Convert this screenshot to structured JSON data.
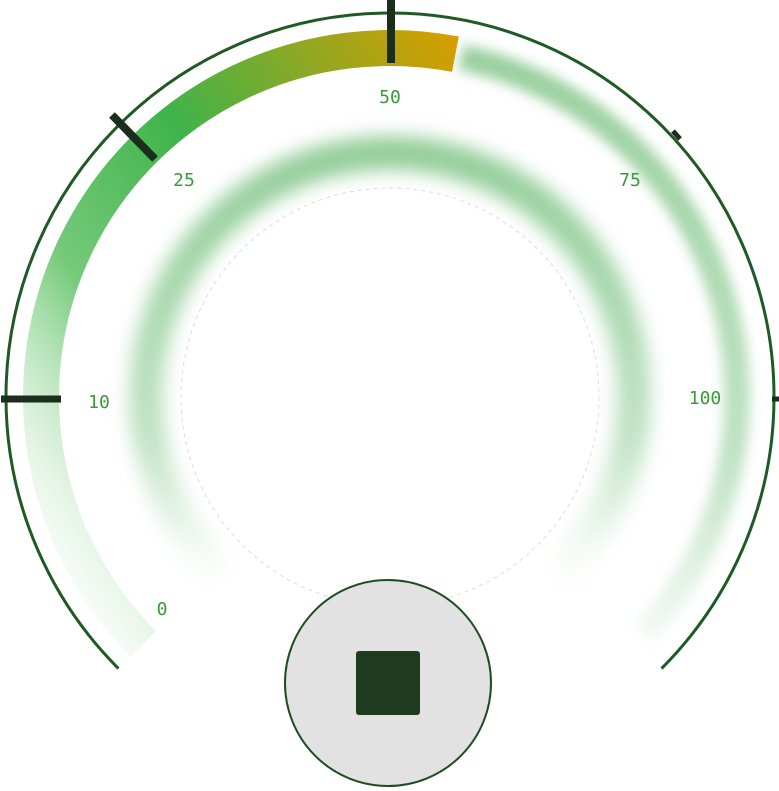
{
  "gauge": {
    "scale_labels": [
      "0",
      "10",
      "25",
      "50",
      "75",
      "100"
    ],
    "current_value_fraction": 0.54,
    "colors": {
      "outer_ring": "#1f5a26",
      "fill_start": "#47b84d",
      "fill_mid": "#3fb34b",
      "fill_end": "#d59e00",
      "track_glow": "#8fcb95",
      "tick_mark": "#1b2e1c",
      "label": "#3a9a3a",
      "inner_dashed": "#dddddd"
    }
  },
  "stop_button": {
    "icon": "stop-icon",
    "background": "#e2e2e2"
  }
}
